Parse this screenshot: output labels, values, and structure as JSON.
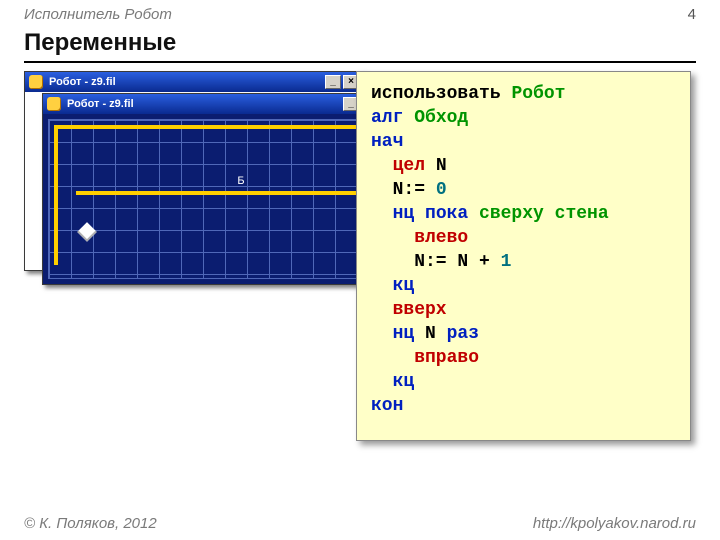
{
  "header": {
    "left": "Исполнитель Робот",
    "page": "4"
  },
  "title": "Переменные",
  "windows": {
    "label": "Робот - z9.fil",
    "minimize": "_",
    "close": "×",
    "grid_label": "Б"
  },
  "code": {
    "l1a": "использовать ",
    "l1b": "Робот",
    "l2a": "алг ",
    "l2b": "Обход",
    "l3": "нач",
    "l4a": "  ",
    "l4b": "цел",
    "l4c": " N",
    "l5a": "  N:= ",
    "l5b": "0",
    "l6a": "  ",
    "l6b": "нц пока ",
    "l6c": "сверху стена",
    "l7": "    влево",
    "l8a": "    N:= N + ",
    "l8b": "1",
    "l9": "  кц",
    "l10": "  вверх",
    "l11a": "  ",
    "l11b": "нц",
    "l11c": " N ",
    "l11d": "раз",
    "l12": "    вправо",
    "l13": "  кц",
    "l14": "кон"
  },
  "footer": {
    "left": "© К. Поляков, 2012",
    "right": "http://kpolyakov.narod.ru"
  }
}
